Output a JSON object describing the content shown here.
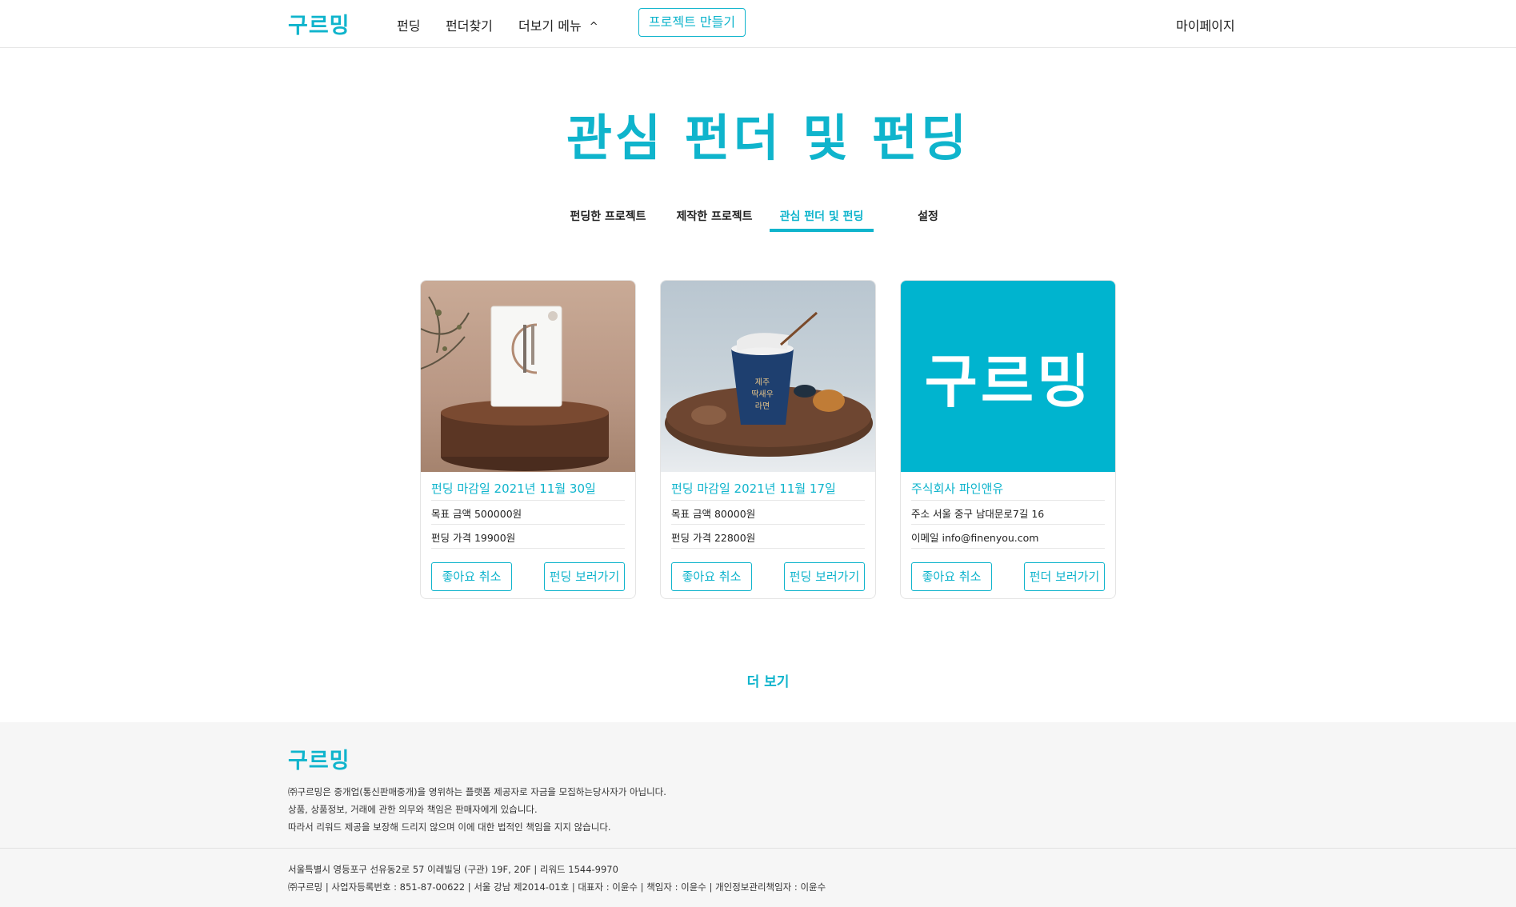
{
  "brand": {
    "logo": "구르밍",
    "accent_color": "#0fb4cc"
  },
  "nav": {
    "links": [
      "펀딩",
      "펀더찾기",
      "더보기 메뉴"
    ],
    "more_menu_icon": "chevron-up-icon",
    "create_button": "프로젝트 만들기",
    "mypage": "마이페이지"
  },
  "page": {
    "title": "관심 펀더 및 펀딩"
  },
  "tabs": [
    {
      "label": "펀딩한 프로젝트",
      "active": false
    },
    {
      "label": "제작한 프로젝트",
      "active": false
    },
    {
      "label": "관심 펀더 및 펀딩",
      "active": true
    },
    {
      "label": "설정",
      "active": false
    }
  ],
  "cards": [
    {
      "image": "product-box-photo",
      "title": "펀딩 마감일 2021년 11월 30일",
      "line1": "목표 금액 500000원",
      "line2": "펀딩 가격 19900원",
      "left_button": "좋아요 취소",
      "right_button": "펀딩 보러가기"
    },
    {
      "image": "ramen-cup-photo",
      "title": "펀딩 마감일 2021년 11월 17일",
      "line1": "목표 금액 80000원",
      "line2": "펀딩 가격 22800원",
      "left_button": "좋아요 취소",
      "right_button": "펀딩 보러가기"
    },
    {
      "image": "brand-logo-tile",
      "logo_text": "구르밍",
      "title": "주식회사 파인앤유",
      "line1": "주소 서울 중구 남대문로7길 16",
      "line2": "이메일 info@finenyou.com",
      "left_button": "좋아요 취소",
      "right_button": "펀더 보러가기"
    }
  ],
  "more_button": "더 보기",
  "footer": {
    "logo": "구르밍",
    "notes": [
      "㈜구르밍은 중개업(통신판매중개)을 영위하는 플랫폼 제공자로 자금을 모집하는당사자가 아닙니다.",
      "상품, 상품정보, 거래에 관한 의무와 책임은 판매자에게 있습니다.",
      "따라서 리워드 제공을 보장해 드리지 않으며 이에 대한 법적인 책임을 지지 않습니다."
    ],
    "address": "서울특별시 영등포구 선유동2로 57 이레빌딩 (구관) 19F, 20F | 리워드 1544-9970",
    "company_info": "㈜구르밍 | 사업자등록번호 : 851-87-00622 | 서울 강남 제2014-01호 | 대표자 : 이윤수 | 책임자 : 이윤수 | 개인정보관리책임자 : 이윤수"
  }
}
